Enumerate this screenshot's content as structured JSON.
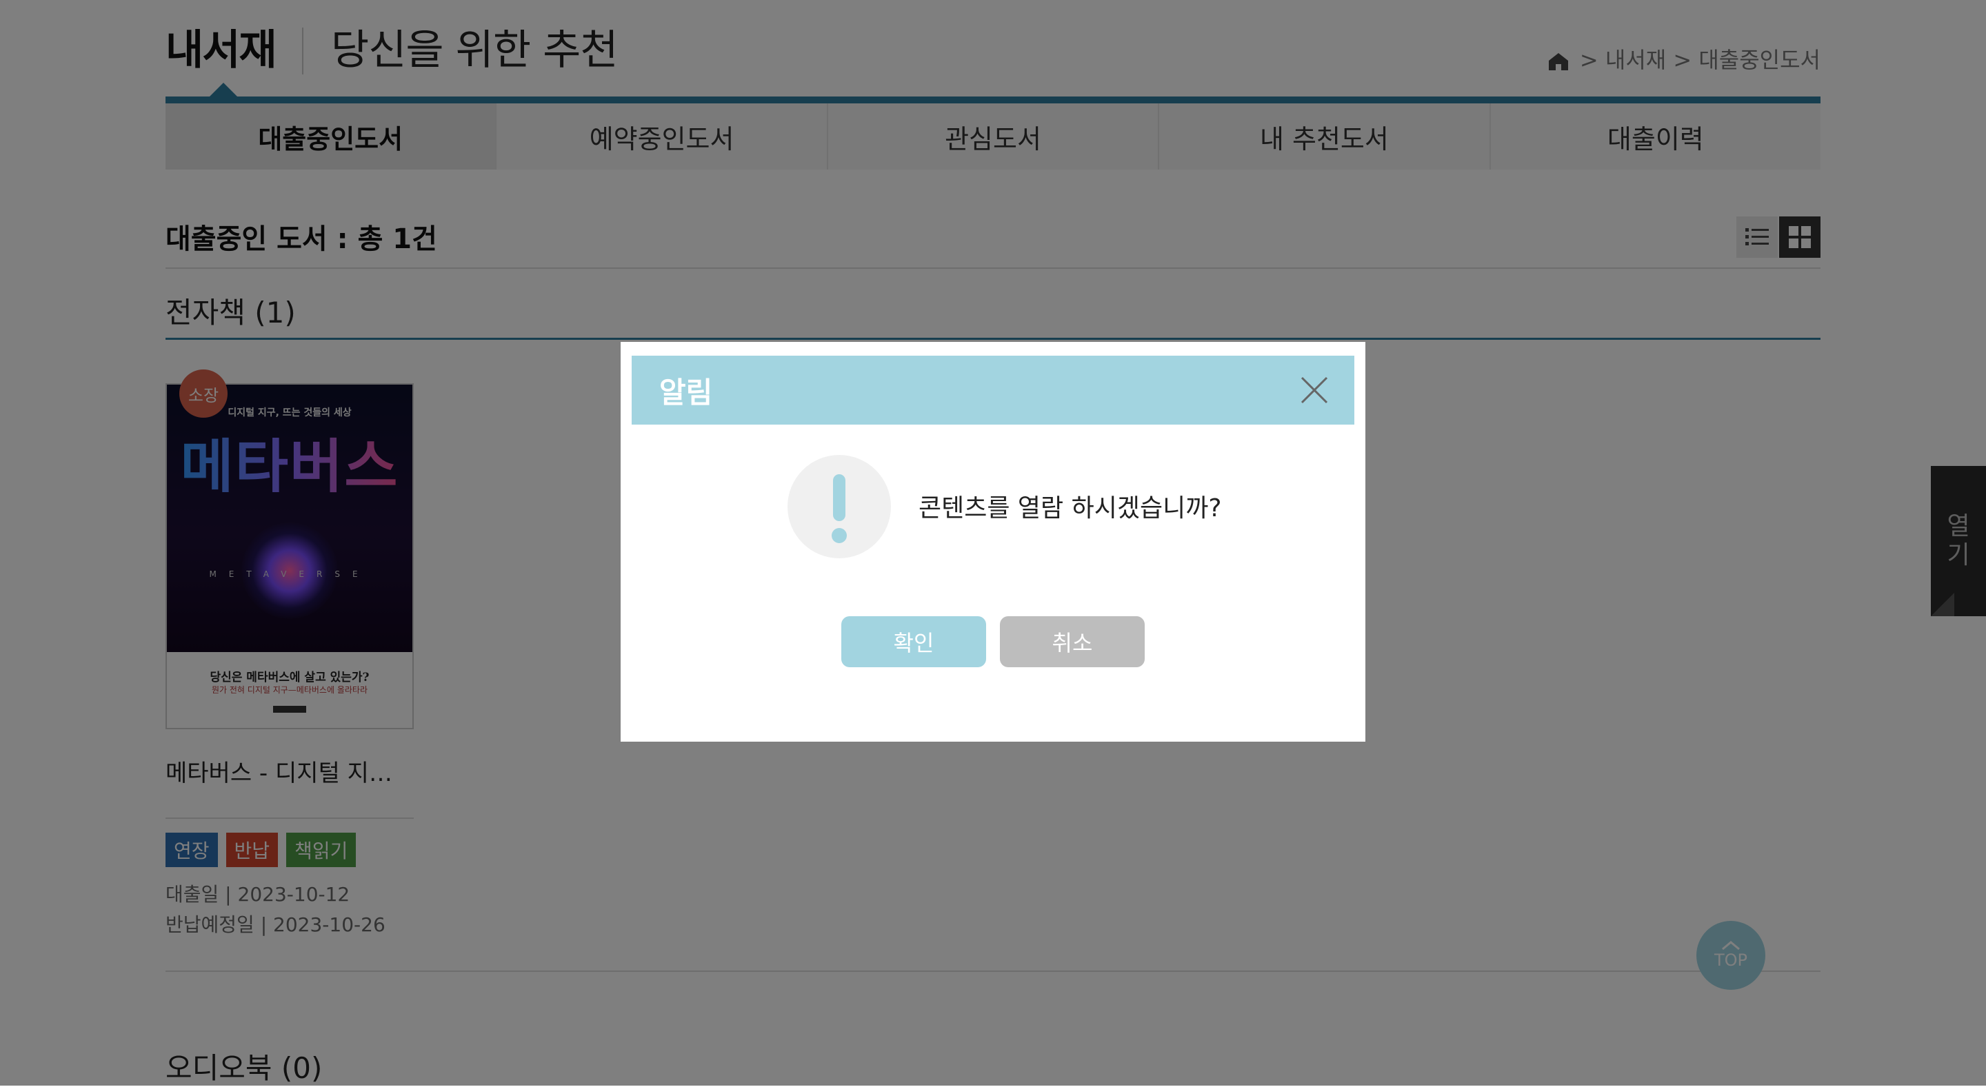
{
  "header": {
    "title": "내서재",
    "subtitle": "당신을 위한 추천",
    "breadcrumb": "> 내서재 > 대출중인도서"
  },
  "tabs": [
    {
      "label": "대출중인도서",
      "active": true
    },
    {
      "label": "예약중인도서",
      "active": false
    },
    {
      "label": "관심도서",
      "active": false
    },
    {
      "label": "내 추천도서",
      "active": false
    },
    {
      "label": "대출이력",
      "active": false
    }
  ],
  "summary": {
    "text": "대출중인 도서 : 총 1건"
  },
  "sections": {
    "ebook_title": "전자책 (1)",
    "audio_title": "오디오북 (0)"
  },
  "book": {
    "badge": "소장",
    "cover_sub": "디지털 지구, 뜨는 것들의 세상",
    "cover_title": "메타버스",
    "cover_meta": "METAVERSE",
    "cover_foot1": "당신은 메타버스에 살고 있는가?",
    "cover_foot2": "뭔가 전혀 디지털 지구—메타버스에 올라타라",
    "title": "메타버스 - 디지털 지구,…",
    "buttons": {
      "extend": "연장",
      "return": "반납",
      "read": "책읽기"
    },
    "loan_date": "대출일 | 2023-10-12",
    "due_date": "반납예정일 | 2023-10-26"
  },
  "side_tab": {
    "label": "열기"
  },
  "top_button": {
    "label": "TOP"
  },
  "modal": {
    "title": "알림",
    "message": "콘텐츠를 열람 하시겠습니까?",
    "confirm": "확인",
    "cancel": "취소"
  },
  "colors": {
    "accent": "#2e7d9e",
    "modal_header": "#a2d4e0",
    "badge": "#d9634c",
    "btn_extend": "#2f6fb0",
    "btn_return": "#d2462e",
    "btn_read": "#4f9a47"
  }
}
